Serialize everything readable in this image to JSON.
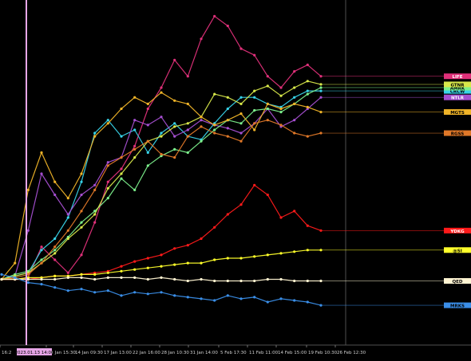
{
  "chart_data": {
    "type": "line",
    "background": "#000000",
    "x_ticks": [
      "16:2",
      "11 Jan 15:30",
      "14 Jan 09:30",
      "17 Jan 13:00",
      "22 Jan 16:00",
      "28 Jan 10:30",
      "31 Jan 14:00",
      "5 Feb 17:30",
      "11 Feb 11:00",
      "14 Feb 15:00",
      "19 Feb 10:30",
      "26 Feb 12:30"
    ],
    "crosshair_label": "2023.01.13 14:00",
    "crosshair_color": "#e7a6e7",
    "series": [
      {
        "name": "LIFE",
        "color": "#e0307a",
        "label_text": "#ffffff",
        "values": [
          100,
          100,
          101,
          120,
          112,
          104,
          115,
          135,
          160,
          168,
          182,
          205,
          218,
          235,
          225,
          248,
          262,
          256,
          242,
          238,
          225,
          218,
          228,
          232,
          225
        ]
      },
      {
        "name": "CRCW",
        "color": "#38d3e8",
        "label_text": "#000000",
        "values": [
          100,
          102,
          104,
          118,
          125,
          138,
          160,
          190,
          198,
          188,
          192,
          178,
          190,
          196,
          188,
          186,
          196,
          205,
          212,
          212,
          208,
          206,
          212,
          216,
          216
        ]
      },
      {
        "name": "NTLR",
        "color": "#a54fd1",
        "label_text": "#ffffff",
        "values": [
          100,
          102,
          130,
          165,
          152,
          140,
          152,
          158,
          172,
          175,
          198,
          195,
          200,
          188,
          192,
          198,
          195,
          193,
          190,
          196,
          205,
          194,
          198,
          205,
          212
        ]
      },
      {
        "name": "AMRK",
        "color": "#7cf08c",
        "label_text": "#000000",
        "values": [
          100,
          103,
          105,
          112,
          118,
          126,
          135,
          142,
          150,
          162,
          155,
          170,
          176,
          180,
          178,
          185,
          192,
          198,
          196,
          204,
          205,
          203,
          208,
          214,
          218
        ]
      },
      {
        "name": "GTNR",
        "color": "#d8e84a",
        "label_text": "#000000",
        "values": [
          100,
          102,
          104,
          110,
          116,
          125,
          132,
          140,
          156,
          165,
          175,
          185,
          188,
          194,
          196,
          200,
          214,
          212,
          208,
          216,
          219,
          213,
          218,
          222,
          220
        ]
      },
      {
        "name": "MGTS",
        "color": "#f0b428",
        "label_text": "#000000",
        "values": [
          100,
          110,
          155,
          178,
          160,
          150,
          165,
          188,
          196,
          205,
          212,
          208,
          215,
          210,
          208,
          200,
          195,
          198,
          202,
          192,
          208,
          205,
          208,
          206,
          203
        ]
      },
      {
        "name": "RGSS",
        "color": "#e07828",
        "label_text": "#000000",
        "values": [
          100,
          101,
          103,
          110,
          120,
          130,
          142,
          155,
          170,
          175,
          180,
          185,
          177,
          175,
          188,
          194,
          190,
          188,
          185,
          196,
          198,
          195,
          190,
          188,
          190
        ]
      },
      {
        "name": "YDKG",
        "color": "#ff1a1a",
        "label_text": "#ffffff",
        "values": [
          100,
          100,
          100,
          101,
          102,
          102,
          103,
          104,
          105,
          108,
          111,
          113,
          115,
          119,
          121,
          125,
          132,
          140,
          146,
          158,
          152,
          138,
          142,
          133,
          130
        ]
      },
      {
        "name": "@SI",
        "color": "#ffff2a",
        "label_text": "#000000",
        "values": [
          100,
          100,
          101,
          101,
          102,
          102,
          103,
          103,
          104,
          105,
          106,
          107,
          108,
          109,
          110,
          110,
          112,
          113,
          113,
          114,
          115,
          116,
          117,
          118,
          118
        ]
      },
      {
        "name": "QED",
        "color": "#fff4d2",
        "label_text": "#000000",
        "values": [
          100,
          100,
          100,
          100,
          100,
          101,
          101,
          100,
          101,
          101,
          101,
          100,
          101,
          100,
          99,
          100,
          99,
          99,
          99,
          99,
          100,
          100,
          99,
          99,
          99
        ]
      },
      {
        "name": "MRKS",
        "color": "#3a8ee8",
        "label_text": "#000000",
        "values": [
          103,
          101,
          98,
          97,
          95,
          93,
          94,
          92,
          93,
          90,
          92,
          91,
          92,
          90,
          89,
          88,
          87,
          90,
          88,
          89,
          86,
          88,
          87,
          86,
          84
        ]
      }
    ],
    "ylim": [
      60,
      270
    ],
    "grid": false,
    "legend": "right-edge labels"
  }
}
